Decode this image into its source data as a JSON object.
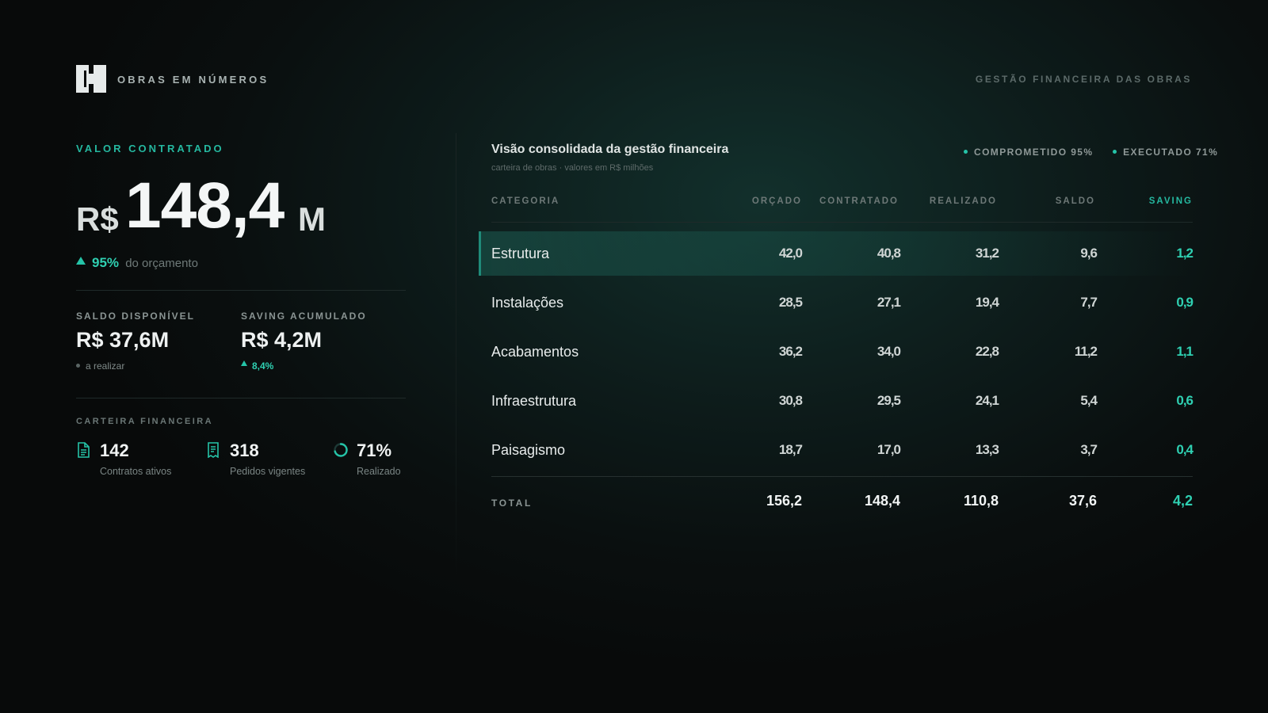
{
  "header": {
    "brand": "OBRAS EM NÚMEROS",
    "right_label": "GESTÃO FINANCEIRA DAS OBRAS",
    "logo_icon": "building-logo-icon"
  },
  "summary": {
    "eyebrow": "VALOR CONTRATADO",
    "currency": "R$",
    "value": "148,4",
    "unit": "M",
    "percent": "95%",
    "percent_label": "do orçamento",
    "saldo": {
      "label": "SALDO DISPONÍVEL",
      "value": "R$ 37,6M",
      "sub": "a realizar"
    },
    "saving": {
      "label": "SAVING ACUMULADO",
      "value": "R$ 4,2M",
      "sub": "8,4%"
    },
    "carteira": {
      "label": "CARTEIRA FINANCEIRA",
      "items": [
        {
          "value": "142",
          "label": "Contratos ativos",
          "icon": "document-icon"
        },
        {
          "value": "318",
          "label": "Pedidos vigentes",
          "icon": "receipt-icon"
        },
        {
          "value": "71%",
          "label": "Realizado",
          "icon": "progress-ring-icon",
          "progress": 0.71
        }
      ]
    }
  },
  "panel": {
    "title": "Visão consolidada da gestão financeira",
    "subtitle": "carteira de obras · valores em R$ milhões",
    "legend": [
      "COMPROMETIDO 95%",
      "EXECUTADO 71%"
    ],
    "accent_color": "#25c4a8"
  },
  "table": {
    "columns": [
      "CATEGORIA",
      "ORÇADO",
      "CONTRATADO",
      "REALIZADO",
      "SALDO",
      "SAVING"
    ],
    "rows": [
      {
        "categoria": "Estrutura",
        "orcado": "42,0",
        "contratado": "40,8",
        "realizado": "31,2",
        "saldo": "9,6",
        "saving": "1,2"
      },
      {
        "categoria": "Instalações",
        "orcado": "28,5",
        "contratado": "27,1",
        "realizado": "19,4",
        "saldo": "7,7",
        "saving": "0,9"
      },
      {
        "categoria": "Acabamentos",
        "orcado": "36,2",
        "contratado": "34,0",
        "realizado": "22,8",
        "saldo": "11,2",
        "saving": "1,1"
      },
      {
        "categoria": "Infraestrutura",
        "orcado": "30,8",
        "contratado": "29,5",
        "realizado": "24,1",
        "saldo": "5,4",
        "saving": "0,6"
      },
      {
        "categoria": "Paisagismo",
        "orcado": "18,7",
        "contratado": "17,0",
        "realizado": "13,3",
        "saldo": "3,7",
        "saving": "0,4"
      }
    ],
    "total": {
      "label": "TOTAL",
      "orcado": "156,2",
      "contratado": "148,4",
      "realizado": "110,8",
      "saldo": "37,6",
      "saving": "4,2"
    }
  }
}
